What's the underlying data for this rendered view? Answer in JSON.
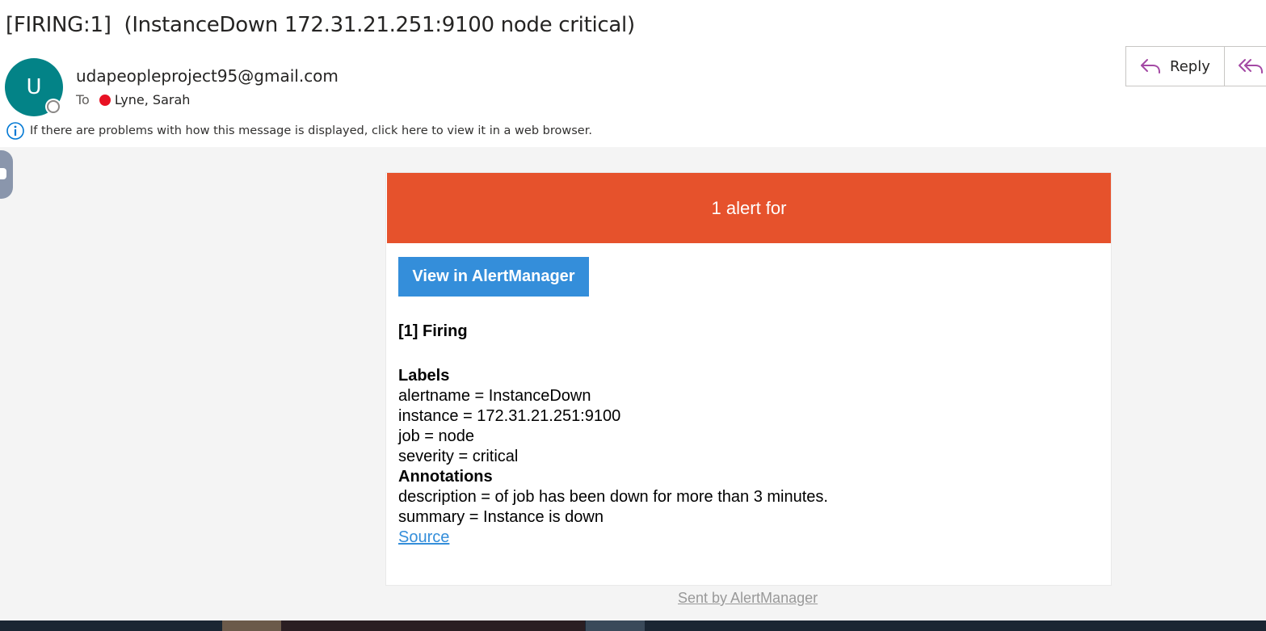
{
  "email": {
    "subject": "[FIRING:1]  (InstanceDown 172.31.21.251:9100 node critical)",
    "sender": "udapeopleproject95@gmail.com",
    "avatar_initial": "U",
    "to_label": "To",
    "recipient": "Lyne, Sarah",
    "info_message": "If there are problems with how this message is displayed, click here to view it in a web browser."
  },
  "actions": {
    "reply_label": "Reply"
  },
  "alert": {
    "banner_text": "1 alert for",
    "view_button": "View in AlertManager",
    "firing_heading": "[1] Firing",
    "labels_heading": "Labels",
    "labels": [
      "alertname = InstanceDown",
      "instance = 172.31.21.251:9100",
      "job = node",
      "severity = critical"
    ],
    "annotations_heading": "Annotations",
    "annotations": [
      "description = of job has been down for more than 3 minutes.",
      "summary = Instance is down"
    ],
    "source_link": "Source",
    "footer": "Sent by AlertManager"
  },
  "colors": {
    "banner": "#e6522c",
    "button": "#348eda",
    "avatar": "#038387",
    "recipient_status": "#e81123"
  },
  "icons": {
    "reply": "reply-arrow-icon",
    "reply_all": "reply-all-arrow-icon",
    "info": "info-circle-icon"
  }
}
